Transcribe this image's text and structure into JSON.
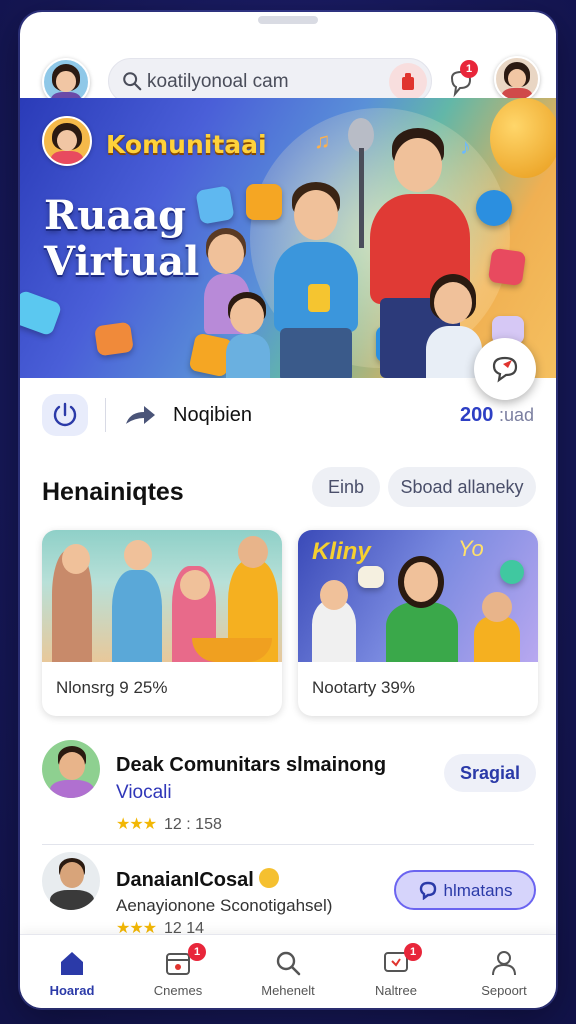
{
  "search": {
    "value": "koatilyonoal cam"
  },
  "header": {
    "notification_count": "1"
  },
  "hero": {
    "brand": "Komunitaai",
    "title_line1": "Ruaag",
    "title_line2": "Virtual"
  },
  "stats": {
    "label": "Noqibien",
    "count": "200",
    "count_suffix": ":uad"
  },
  "section": {
    "title": "Henainiqtes",
    "pill_left": "Einb",
    "pill_right": "Sboad allaneky"
  },
  "cards": [
    {
      "caption": "Nlonsrg 9 25%"
    },
    {
      "caption": "Nootarty 39%",
      "overlay_text": "Kliny",
      "overlay_yo": "Yo"
    }
  ],
  "list": [
    {
      "title": "Deak Comunitars slmainong",
      "subtitle": "Viocali",
      "stars": "★★★",
      "meta": "12 : 158",
      "button": "Sragial"
    },
    {
      "title": "DanaianICosal",
      "subtitle": "Aenayionone Sconotigahsel)",
      "stars": "★★★",
      "meta": "12 14",
      "button": "hlmatans"
    }
  ],
  "nav": [
    {
      "label": "Hoarad",
      "icon": "home-icon",
      "active": true
    },
    {
      "label": "Cnemes",
      "icon": "calendar-icon",
      "badge": "1"
    },
    {
      "label": "Mehenelt",
      "icon": "search-icon"
    },
    {
      "label": "Naltree",
      "icon": "chat-icon",
      "badge": "1"
    },
    {
      "label": "Sepoort",
      "icon": "profile-icon"
    }
  ],
  "colors": {
    "accent": "#2b3aa8",
    "badge": "#e8263a",
    "background": "#181a5e",
    "star": "#f2b705"
  }
}
